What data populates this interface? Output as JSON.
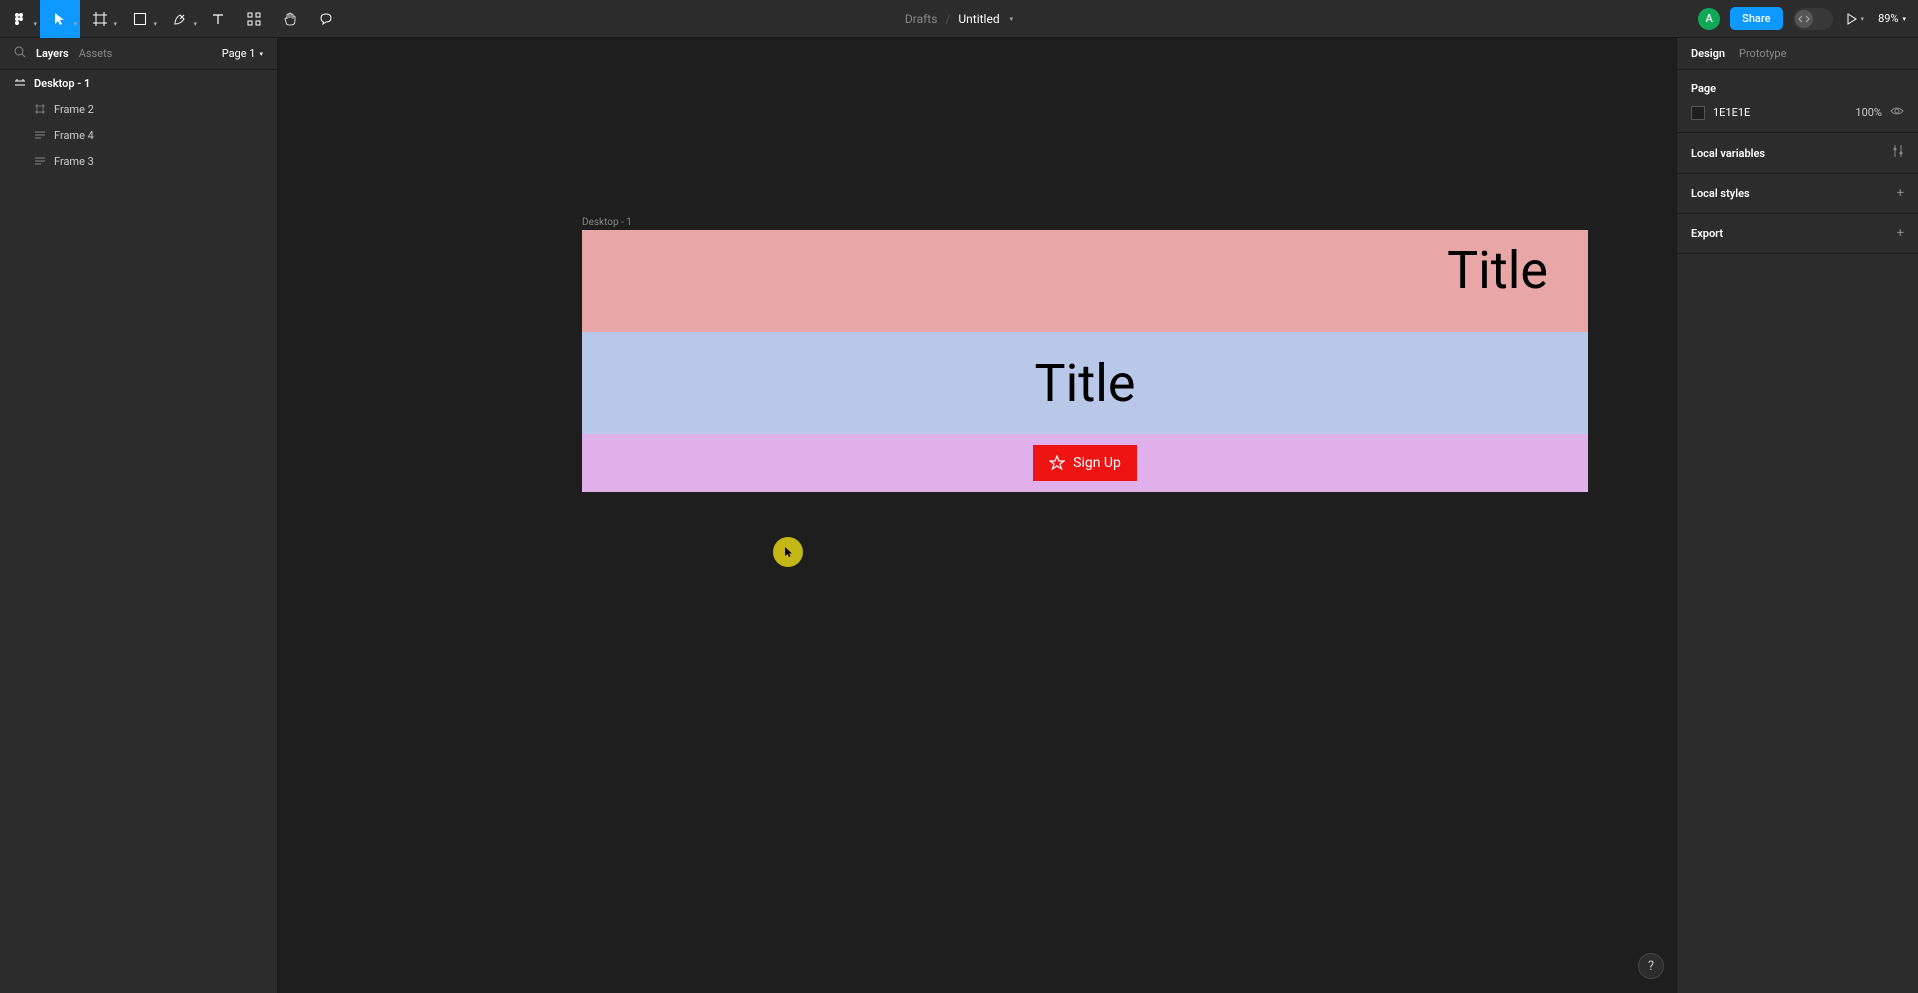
{
  "toolbar": {
    "breadcrumb_drafts": "Drafts",
    "breadcrumb_slash": "/",
    "filename": "Untitled",
    "avatar_initial": "A",
    "share_label": "Share",
    "zoom": "89%"
  },
  "left_panel": {
    "tab_layers": "Layers",
    "tab_assets": "Assets",
    "page_selector": "Page 1",
    "layers": [
      {
        "name": "Desktop - 1",
        "type": "frame-root"
      },
      {
        "name": "Frame 2",
        "type": "frame"
      },
      {
        "name": "Frame 4",
        "type": "text-frame"
      },
      {
        "name": "Frame 3",
        "type": "text-frame"
      }
    ]
  },
  "right_panel": {
    "tab_design": "Design",
    "tab_prototype": "Prototype",
    "page_section": "Page",
    "page_color": "1E1E1E",
    "page_opacity": "100%",
    "local_variables": "Local variables",
    "local_styles": "Local styles",
    "export": "Export"
  },
  "canvas": {
    "frame_label": "Desktop - 1",
    "row1_title": "Title",
    "row2_title": "Title",
    "signup_label": "Sign Up"
  },
  "help_label": "?"
}
